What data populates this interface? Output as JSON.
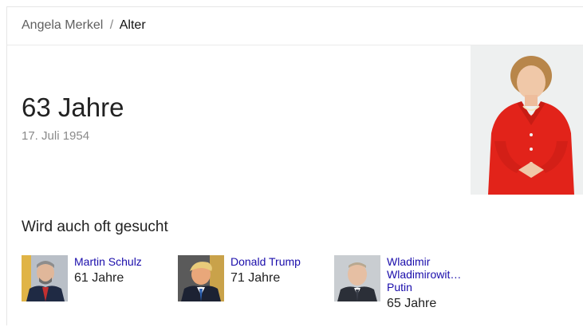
{
  "breadcrumb": {
    "parent": "Angela Merkel",
    "separator": "/",
    "current": "Alter"
  },
  "main": {
    "age": "63 Jahre",
    "birthdate": "17. Juli 1954"
  },
  "related": {
    "title": "Wird auch oft gesucht",
    "people": [
      {
        "name": "Martin Schulz",
        "age": "61 Jahre"
      },
      {
        "name": "Donald Trump",
        "age": "71 Jahre"
      },
      {
        "name_line1": "Wladimir",
        "name_line2": "Wladimirowit…",
        "name_line3": "Putin",
        "age": "65 Jahre"
      }
    ]
  },
  "colors": {
    "link": "#1a0dab",
    "jacket": "#e2231a"
  }
}
